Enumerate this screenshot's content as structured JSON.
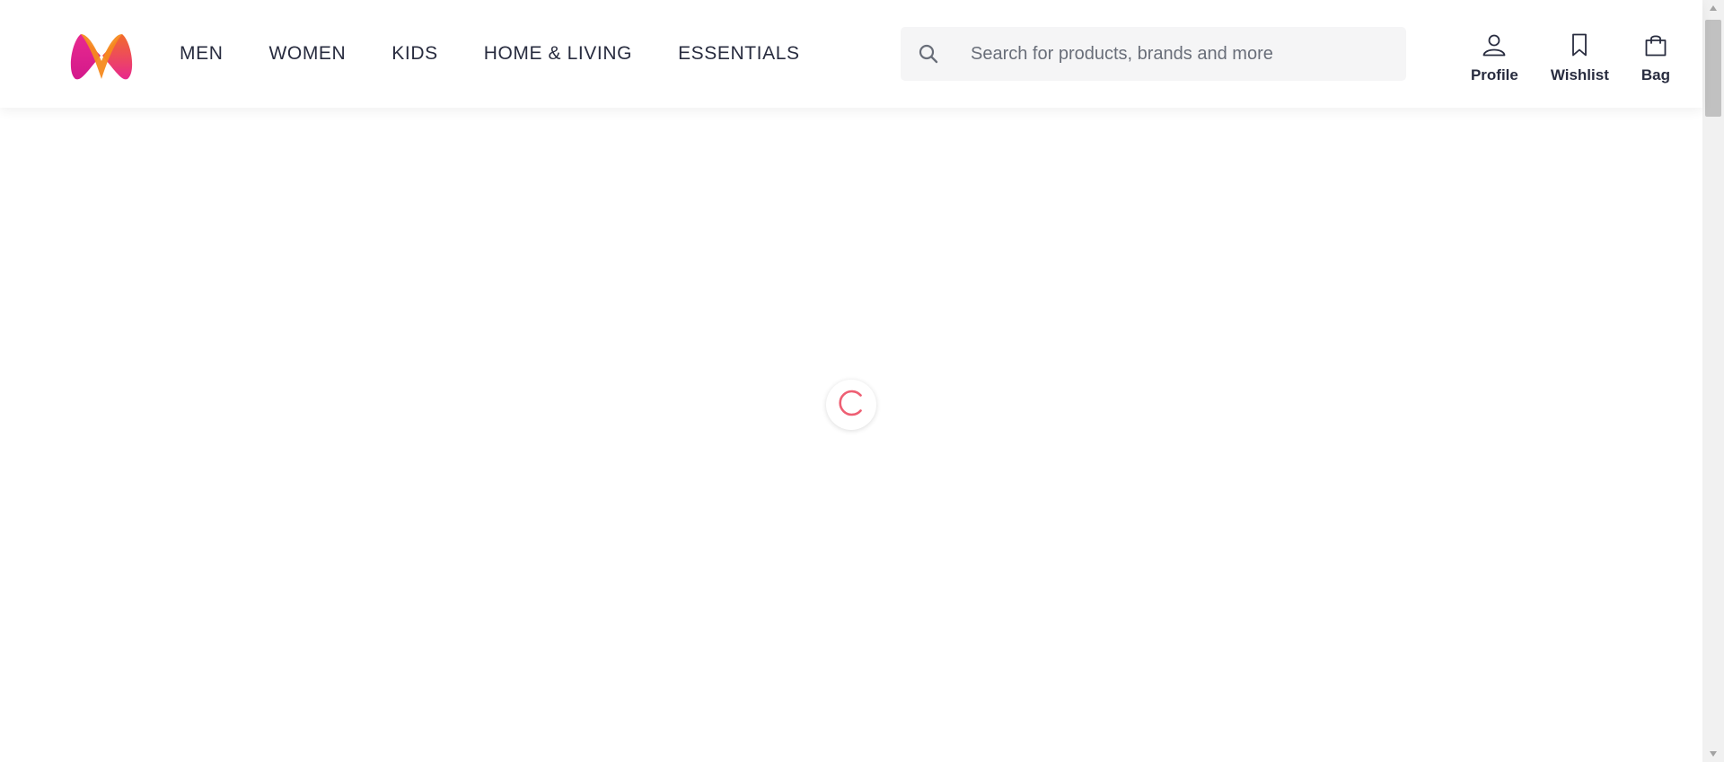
{
  "header": {
    "logo": "myntra-logo",
    "nav": [
      {
        "label": "MEN"
      },
      {
        "label": "WOMEN"
      },
      {
        "label": "KIDS"
      },
      {
        "label": "HOME & LIVING"
      },
      {
        "label": "ESSENTIALS"
      }
    ],
    "search": {
      "placeholder": "Search for products, brands and more",
      "value": "",
      "icon": "search-icon"
    },
    "actions": [
      {
        "label": "Profile",
        "icon": "profile-icon"
      },
      {
        "label": "Wishlist",
        "icon": "bookmark-icon"
      },
      {
        "label": "Bag",
        "icon": "bag-icon"
      }
    ]
  },
  "main": {
    "state": "loading",
    "spinner_icon": "loading-spinner-icon"
  },
  "colors": {
    "text": "#282c3f",
    "search_bg": "#f5f5f6",
    "spinner": "#ee5f73",
    "logo_pink": "#e91e8c",
    "logo_orange": "#f47b20"
  }
}
